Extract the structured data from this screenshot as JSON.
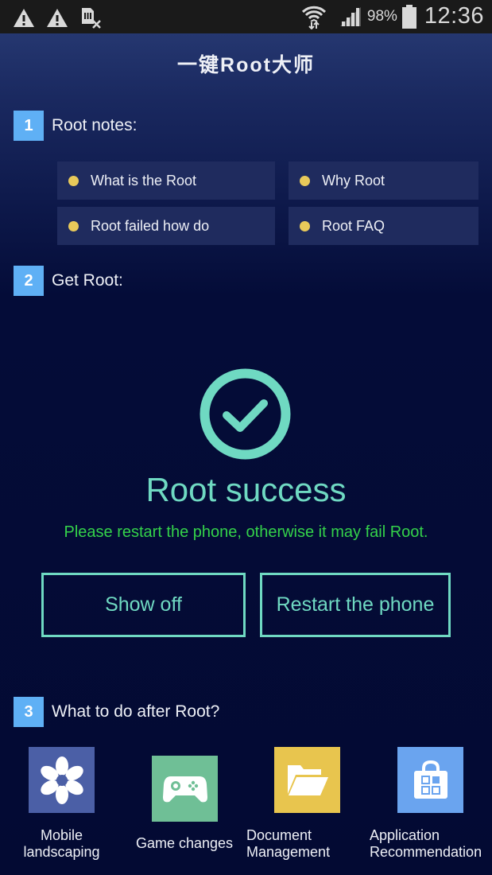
{
  "status_bar": {
    "left_icons": [
      "warning-icon",
      "warning-icon",
      "sim-missing-icon"
    ],
    "right_icons": [
      "wifi-icon",
      "signal-icon",
      "battery-icon"
    ],
    "battery_percent": "98%",
    "time": "12:36"
  },
  "header": {
    "title": "一键Root大师"
  },
  "sections": [
    {
      "number": "1",
      "label": "Root notes:"
    },
    {
      "number": "2",
      "label": "Get Root:"
    },
    {
      "number": "3",
      "label": "What to do after Root?"
    }
  ],
  "notes": [
    {
      "label": "What is the Root"
    },
    {
      "label": "Why Root"
    },
    {
      "label": "Root failed how do"
    },
    {
      "label": "Root FAQ"
    }
  ],
  "result": {
    "icon": "check-circle-icon",
    "title": "Root success",
    "message": "Please restart the phone, otherwise it may fail Root."
  },
  "actions": {
    "show_off": "Show off",
    "restart": "Restart the phone"
  },
  "tools": [
    {
      "icon": "flower-icon",
      "label_line1": "Mobile",
      "label_line2": "landscaping",
      "color": "#4b5fa6"
    },
    {
      "icon": "gamepad-icon",
      "label_line1": "Game changes",
      "label_line2": "",
      "color": "#6fbf96"
    },
    {
      "icon": "folder-icon",
      "label_line1": "Document",
      "label_line2": "Management",
      "color": "#e8c54e"
    },
    {
      "icon": "shopping-bag-icon",
      "label_line1": "Application",
      "label_line2": "Recommendation",
      "color": "#6aa4ef"
    }
  ],
  "colors": {
    "accent_teal": "#6fd9c2",
    "success_green": "#34d24a",
    "badge_blue": "#5fb0f5",
    "bullet_yellow": "#e8c95a",
    "background": "#030a33"
  }
}
